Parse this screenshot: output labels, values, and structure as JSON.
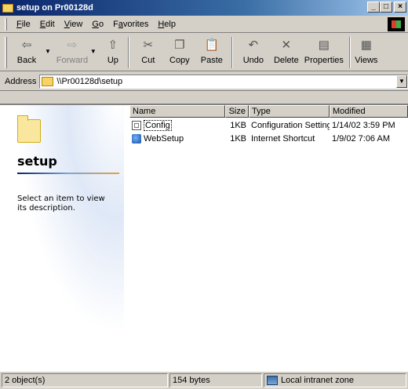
{
  "window": {
    "title": "setup on Pr00128d"
  },
  "menu": [
    {
      "key": "F",
      "rest": "ile"
    },
    {
      "key": "E",
      "rest": "dit"
    },
    {
      "key": "V",
      "rest": "iew"
    },
    {
      "key": "G",
      "rest": "o"
    },
    {
      "pre": "F",
      "key": "a",
      "rest": "vorites"
    },
    {
      "key": "H",
      "rest": "elp"
    }
  ],
  "toolbar": {
    "back": "Back",
    "forward": "Forward",
    "up": "Up",
    "cut": "Cut",
    "copy": "Copy",
    "paste": "Paste",
    "undo": "Undo",
    "delete": "Delete",
    "properties": "Properties",
    "views": "Views"
  },
  "address": {
    "label": "Address",
    "value": "\\\\Pr00128d\\setup"
  },
  "left_pane": {
    "title": "setup",
    "description": "Select an item to view its description."
  },
  "list": {
    "columns": [
      "Name",
      "Size",
      "Type",
      "Modified"
    ],
    "rows": [
      {
        "name": "Config",
        "size": "1KB",
        "type": "Configuration Settings",
        "modified": "1/14/02 3:59 PM",
        "icon": "settings-file-icon"
      },
      {
        "name": "WebSetup",
        "size": "1KB",
        "type": "Internet Shortcut",
        "modified": "1/9/02 7:06 AM",
        "icon": "internet-shortcut-icon"
      }
    ]
  },
  "status": {
    "objects": "2 object(s)",
    "size": "154 bytes",
    "zone": "Local intranet zone"
  },
  "colors": {
    "titlebar": "#0a246a",
    "chrome": "#d4d0c8"
  }
}
